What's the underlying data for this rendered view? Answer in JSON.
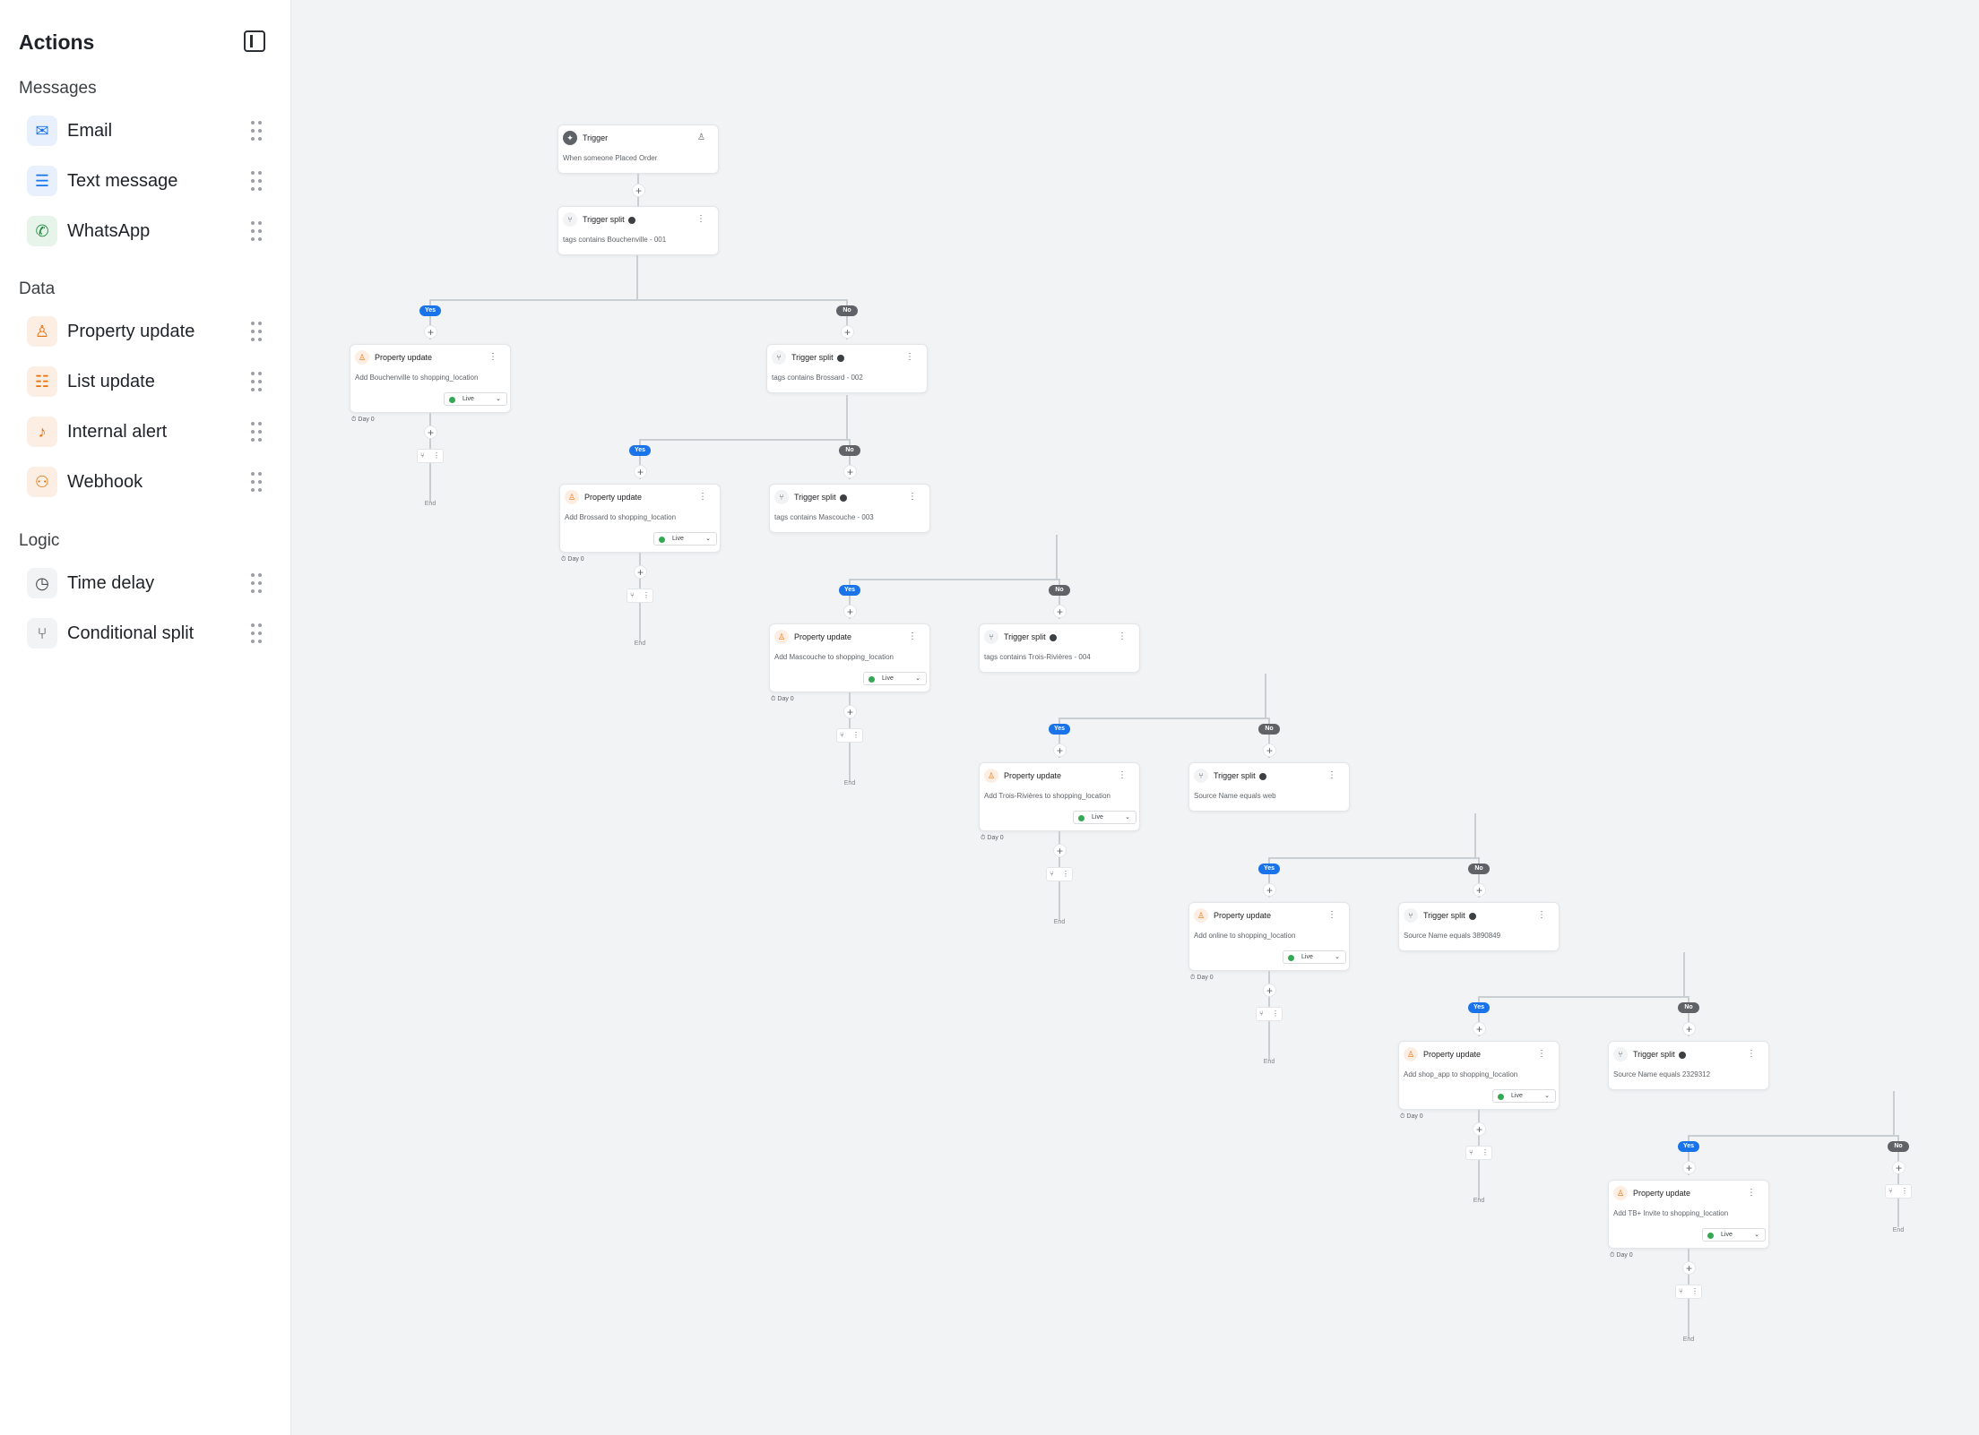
{
  "sidebar": {
    "title": "Actions",
    "sections": [
      {
        "label": "Messages",
        "items": [
          {
            "label": "Email",
            "icon": "mail-icon",
            "bg": "#e8f0fe",
            "fg": "#1a73e8"
          },
          {
            "label": "Text message",
            "icon": "sms-icon",
            "bg": "#e8f0fe",
            "fg": "#1a73e8"
          },
          {
            "label": "WhatsApp",
            "icon": "whatsapp-icon",
            "bg": "#e6f4ea",
            "fg": "#1e8e3e"
          }
        ]
      },
      {
        "label": "Data",
        "items": [
          {
            "label": "Property update",
            "icon": "user-edit-icon",
            "bg": "#fdeee3",
            "fg": "#e8710a"
          },
          {
            "label": "List update",
            "icon": "list-icon",
            "bg": "#fdeee3",
            "fg": "#e8710a"
          },
          {
            "label": "Internal alert",
            "icon": "bell-icon",
            "bg": "#fdeee3",
            "fg": "#e8710a"
          },
          {
            "label": "Webhook",
            "icon": "webhook-icon",
            "bg": "#fdeee3",
            "fg": "#e8710a"
          }
        ]
      },
      {
        "label": "Logic",
        "items": [
          {
            "label": "Time delay",
            "icon": "clock-icon",
            "bg": "#f1f3f4",
            "fg": "#3c4043"
          },
          {
            "label": "Conditional split",
            "icon": "split-icon",
            "bg": "#f1f3f4",
            "fg": "#3c4043"
          }
        ]
      }
    ]
  },
  "flow": {
    "trigger": {
      "title": "Trigger",
      "desc": "When someone Placed Order"
    },
    "split1": {
      "title": "Trigger split",
      "desc": "tags contains Bouchenville - 001"
    },
    "splits": [
      {
        "title": "Trigger split",
        "desc": "tags contains Brossard - 002"
      },
      {
        "title": "Trigger split",
        "desc": "tags contains Mascouche - 003"
      },
      {
        "title": "Trigger split",
        "desc": "tags contains Trois-Rivières - 004"
      },
      {
        "title": "Trigger split",
        "desc": "Source Name equals web"
      },
      {
        "title": "Trigger split",
        "desc": "Source Name equals 3890849"
      },
      {
        "title": "Trigger split",
        "desc": "Source Name equals 2329312"
      }
    ],
    "updates": [
      {
        "title": "Property update",
        "desc": "Add Bouchenville to shopping_location"
      },
      {
        "title": "Property update",
        "desc": "Add Brossard to shopping_location"
      },
      {
        "title": "Property update",
        "desc": "Add Mascouche to shopping_location"
      },
      {
        "title": "Property update",
        "desc": "Add Trois-Rivières to shopping_location"
      },
      {
        "title": "Property update",
        "desc": "Add online to shopping_location"
      },
      {
        "title": "Property update",
        "desc": "Add shop_app to shopping_location"
      },
      {
        "title": "Property update",
        "desc": "Add TB+ Invite to shopping_location"
      }
    ],
    "status": "Live",
    "day": "Day 0",
    "yes": "Yes",
    "no": "No",
    "end": "End",
    "plus": "+"
  }
}
